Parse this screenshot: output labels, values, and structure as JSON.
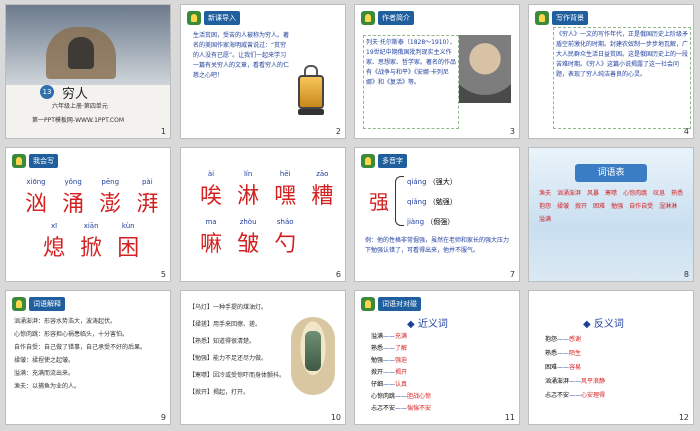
{
  "slides": [
    {
      "num": "1",
      "title_no": "13",
      "title": "穷人",
      "sub": "六年级上册·第四单元",
      "footer": "第一PPT模板网-WWW.1PPT.COM"
    },
    {
      "num": "2",
      "label": "新课导入",
      "text": "生活贫困，受苦的人被称为穷人。著名的美国作家海明威曾说过：“贫穷的人没有已愿”。让我们一起来学习一篇有关穷人的文章，看看穷人的仁慈之心吧！"
    },
    {
      "num": "3",
      "label": "作者简介",
      "text": "列夫·托尔斯泰（1828～1910），19世纪中期俄国批判现实主义作家、思想家、哲学家。著名的作品有《战争与和平》《安娜·卡列尼娜》和《复活》等。"
    },
    {
      "num": "4",
      "label": "写作背景",
      "text": "《穷人》一文的写作年代，正是俄国历史上阶级矛盾空前激化的时期。封建农奴制一步步地瓦解，广大人民群众生活日益贫困。这是俄国历史上的一段苦难时期。《穷人》这篇小说揭露了这一社会问题，表现了穷人纯洁善良的心灵。"
    },
    {
      "num": "5",
      "label": "我会写",
      "row1_py": [
        "xiōng",
        "yǒng",
        "pēng",
        "pài"
      ],
      "row1": [
        "汹",
        "涌",
        "澎",
        "湃"
      ],
      "row2_py": [
        "xī",
        "xiān",
        "kùn"
      ],
      "row2": [
        "熄",
        "掀",
        "困"
      ]
    },
    {
      "num": "6",
      "row1_py": [
        "ài",
        "lín",
        "hēi",
        "zāo"
      ],
      "row1": [
        "唉",
        "淋",
        "嘿",
        "糟"
      ],
      "row2_py": [
        "ma",
        "zhòu",
        "sháo"
      ],
      "row2": [
        "嘛",
        "皱",
        "勺"
      ]
    },
    {
      "num": "7",
      "label": "多音字",
      "char": "强",
      "items": [
        {
          "py": "qiáng",
          "w": "（强大）"
        },
        {
          "py": "qiǎng",
          "w": "（勉强）"
        },
        {
          "py": "jiàng",
          "w": "（倔强）"
        }
      ],
      "example": "例：他的性格非常倔强，虽然在老师和家长的强大压力下勉强认错了，可看得出来，他并不服气。"
    },
    {
      "num": "8",
      "title": "词语表",
      "words": [
        "渔夫",
        "汹涌澎湃",
        "风暴",
        "寒噤",
        "心惊肉跳",
        "叹息",
        "熟悉",
        "抱怨",
        "揉皱",
        "掀开",
        "困难",
        "勉强",
        "自作自受",
        "湿淋淋",
        "溢满"
      ]
    },
    {
      "num": "9",
      "label": "词语解释",
      "lines": [
        "汹涌澎湃：形容水势浩大，波涛起伏。",
        "心惊肉跳：形容担心祸患临头，十分害怕。",
        "自作自受：自己做了错事，自己承受不好的后果。",
        "揉皱：揉捏使之起皱。",
        "溢满：充满而流出来。",
        "渔夫：以捕鱼为业的人。"
      ]
    },
    {
      "num": "10",
      "lines": [
        "【乌灯】一种手提的煤油灯。",
        "【揉搓】用手来回擦、搓。",
        "【熟悉】知道得很清楚。",
        "【勉强】能力不足还尽力做。",
        "【寒噤】因冷或受惊吓而身体颤抖。",
        "【掀开】揭起，打开。"
      ]
    },
    {
      "num": "11",
      "label": "词语对对碰",
      "title": "◆ 近义词",
      "pairs": [
        [
          "溢满",
          "——",
          "充满"
        ],
        [
          "熟悉",
          "——",
          "了解"
        ],
        [
          "勉强",
          "——",
          "强迫"
        ],
        [
          "掀开",
          "——",
          "揭开"
        ],
        [
          "仔细",
          "——",
          "认真"
        ],
        [
          "心惊肉跳",
          "——",
          "胆战心惊"
        ],
        [
          "忐忑不安",
          "——",
          "惴惴不安"
        ]
      ]
    },
    {
      "num": "12",
      "title": "◆ 反义词",
      "pairs": [
        [
          "抱怨",
          "——",
          "感谢"
        ],
        [
          "熟悉",
          "——",
          "陌生"
        ],
        [
          "困难",
          "——",
          "容易"
        ],
        [
          "汹涌澎湃",
          "——",
          "风平浪静"
        ],
        [
          "忐忑不安",
          "——",
          "心安理得"
        ]
      ]
    }
  ]
}
